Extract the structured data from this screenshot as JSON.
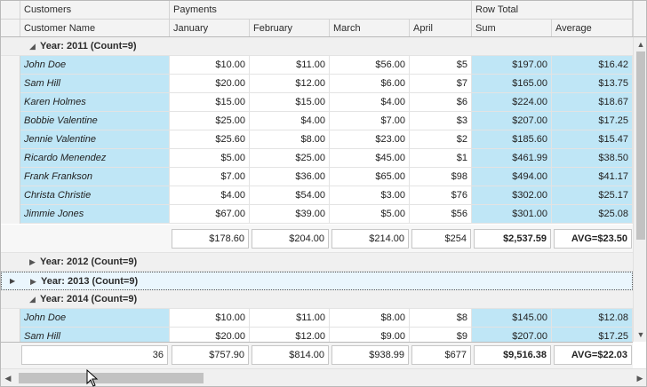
{
  "header": {
    "bands": {
      "customers": "Customers",
      "payments": "Payments",
      "row_total": "Row Total"
    },
    "columns": {
      "customer_name": "Customer Name",
      "january": "January",
      "february": "February",
      "march": "March",
      "april": "April",
      "sum": "Sum",
      "average": "Average"
    }
  },
  "groups": {
    "g2011": {
      "label": "Year: 2011 (Count=9)",
      "rows": {
        "r0": {
          "name": "John Doe",
          "jan": "$10.00",
          "feb": "$11.00",
          "mar": "$56.00",
          "apr": "$5",
          "sum": "$197.00",
          "avg": "$16.42"
        },
        "r1": {
          "name": "Sam Hill",
          "jan": "$20.00",
          "feb": "$12.00",
          "mar": "$6.00",
          "apr": "$7",
          "sum": "$165.00",
          "avg": "$13.75"
        },
        "r2": {
          "name": "Karen Holmes",
          "jan": "$15.00",
          "feb": "$15.00",
          "mar": "$4.00",
          "apr": "$6",
          "sum": "$224.00",
          "avg": "$18.67"
        },
        "r3": {
          "name": "Bobbie Valentine",
          "jan": "$25.00",
          "feb": "$4.00",
          "mar": "$7.00",
          "apr": "$3",
          "sum": "$207.00",
          "avg": "$17.25"
        },
        "r4": {
          "name": "Jennie Valentine",
          "jan": "$25.60",
          "feb": "$8.00",
          "mar": "$23.00",
          "apr": "$2",
          "sum": "$185.60",
          "avg": "$15.47"
        },
        "r5": {
          "name": "Ricardo Menendez",
          "jan": "$5.00",
          "feb": "$25.00",
          "mar": "$45.00",
          "apr": "$1",
          "sum": "$461.99",
          "avg": "$38.50"
        },
        "r6": {
          "name": "Frank Frankson",
          "jan": "$7.00",
          "feb": "$36.00",
          "mar": "$65.00",
          "apr": "$98",
          "sum": "$494.00",
          "avg": "$41.17"
        },
        "r7": {
          "name": "Christa Christie",
          "jan": "$4.00",
          "feb": "$54.00",
          "mar": "$3.00",
          "apr": "$76",
          "sum": "$302.00",
          "avg": "$25.17"
        },
        "r8": {
          "name": "Jimmie Jones",
          "jan": "$67.00",
          "feb": "$39.00",
          "mar": "$5.00",
          "apr": "$56",
          "sum": "$301.00",
          "avg": "$25.08"
        }
      },
      "footer": {
        "jan": "$178.60",
        "feb": "$204.00",
        "mar": "$214.00",
        "apr": "$254",
        "sum": "$2,537.59",
        "avg": "AVG=$23.50"
      }
    },
    "g2012": {
      "label": "Year: 2012 (Count=9)"
    },
    "g2013": {
      "label": "Year: 2013 (Count=9)"
    },
    "g2014": {
      "label": "Year: 2014 (Count=9)",
      "rows": {
        "r0": {
          "name": "John Doe",
          "jan": "$10.00",
          "feb": "$11.00",
          "mar": "$8.00",
          "apr": "$8",
          "sum": "$145.00",
          "avg": "$12.08"
        },
        "r1": {
          "name": "Sam Hill",
          "jan": "$20.00",
          "feb": "$12.00",
          "mar": "$9.00",
          "apr": "$9",
          "sum": "$207.00",
          "avg": "$17.25"
        }
      }
    }
  },
  "totals": {
    "count": "36",
    "jan": "$757.90",
    "feb": "$814.00",
    "mar": "$938.99",
    "apr": "$677",
    "sum": "$9,516.38",
    "avg": "AVG=$22.03"
  },
  "icons": {
    "expand": "expand-group-icon",
    "collapse": "collapse-group-icon",
    "row_indicator": "row-indicator-icon",
    "scroll_up": "scroll-up-icon",
    "scroll_down": "scroll-down-icon",
    "scroll_left": "scroll-left-icon",
    "scroll_right": "scroll-right-icon"
  },
  "colors": {
    "highlight": "#bfe6f6",
    "header_bg": "#f3f3f3",
    "border": "#b9b9b9"
  }
}
